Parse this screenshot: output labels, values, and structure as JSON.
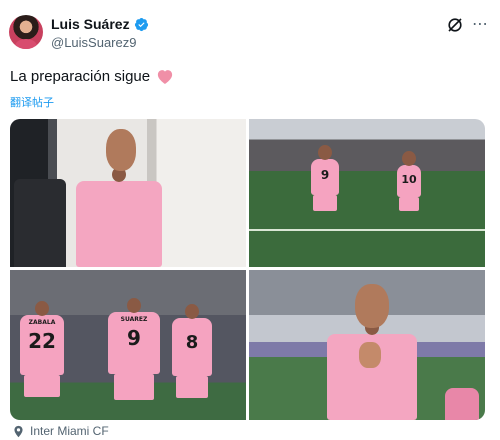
{
  "author": {
    "display_name": "Luis Suárez",
    "handle": "@LuisSuarez9"
  },
  "icons": {
    "avatar": "avatar-image",
    "verified": "verified-badge-icon",
    "grok": "grok-icon",
    "more": "more-options-icon",
    "heart": "pink-heart-emoji",
    "source": "location-pin-icon"
  },
  "tweet": {
    "text": "La preparación sigue",
    "translate_label": "翻译帖子"
  },
  "media": {
    "jerseys": [
      "9",
      "10",
      "22",
      "9",
      "8"
    ],
    "jersey_names": [
      "ZABALA",
      "SUAREZ"
    ]
  },
  "source": {
    "label": "Inter Miami CF"
  },
  "colors": {
    "accent": "#1d9bf0",
    "heart": "#f08fa7",
    "jersey_pink": "#f5a3c0",
    "text_secondary": "#536471"
  }
}
